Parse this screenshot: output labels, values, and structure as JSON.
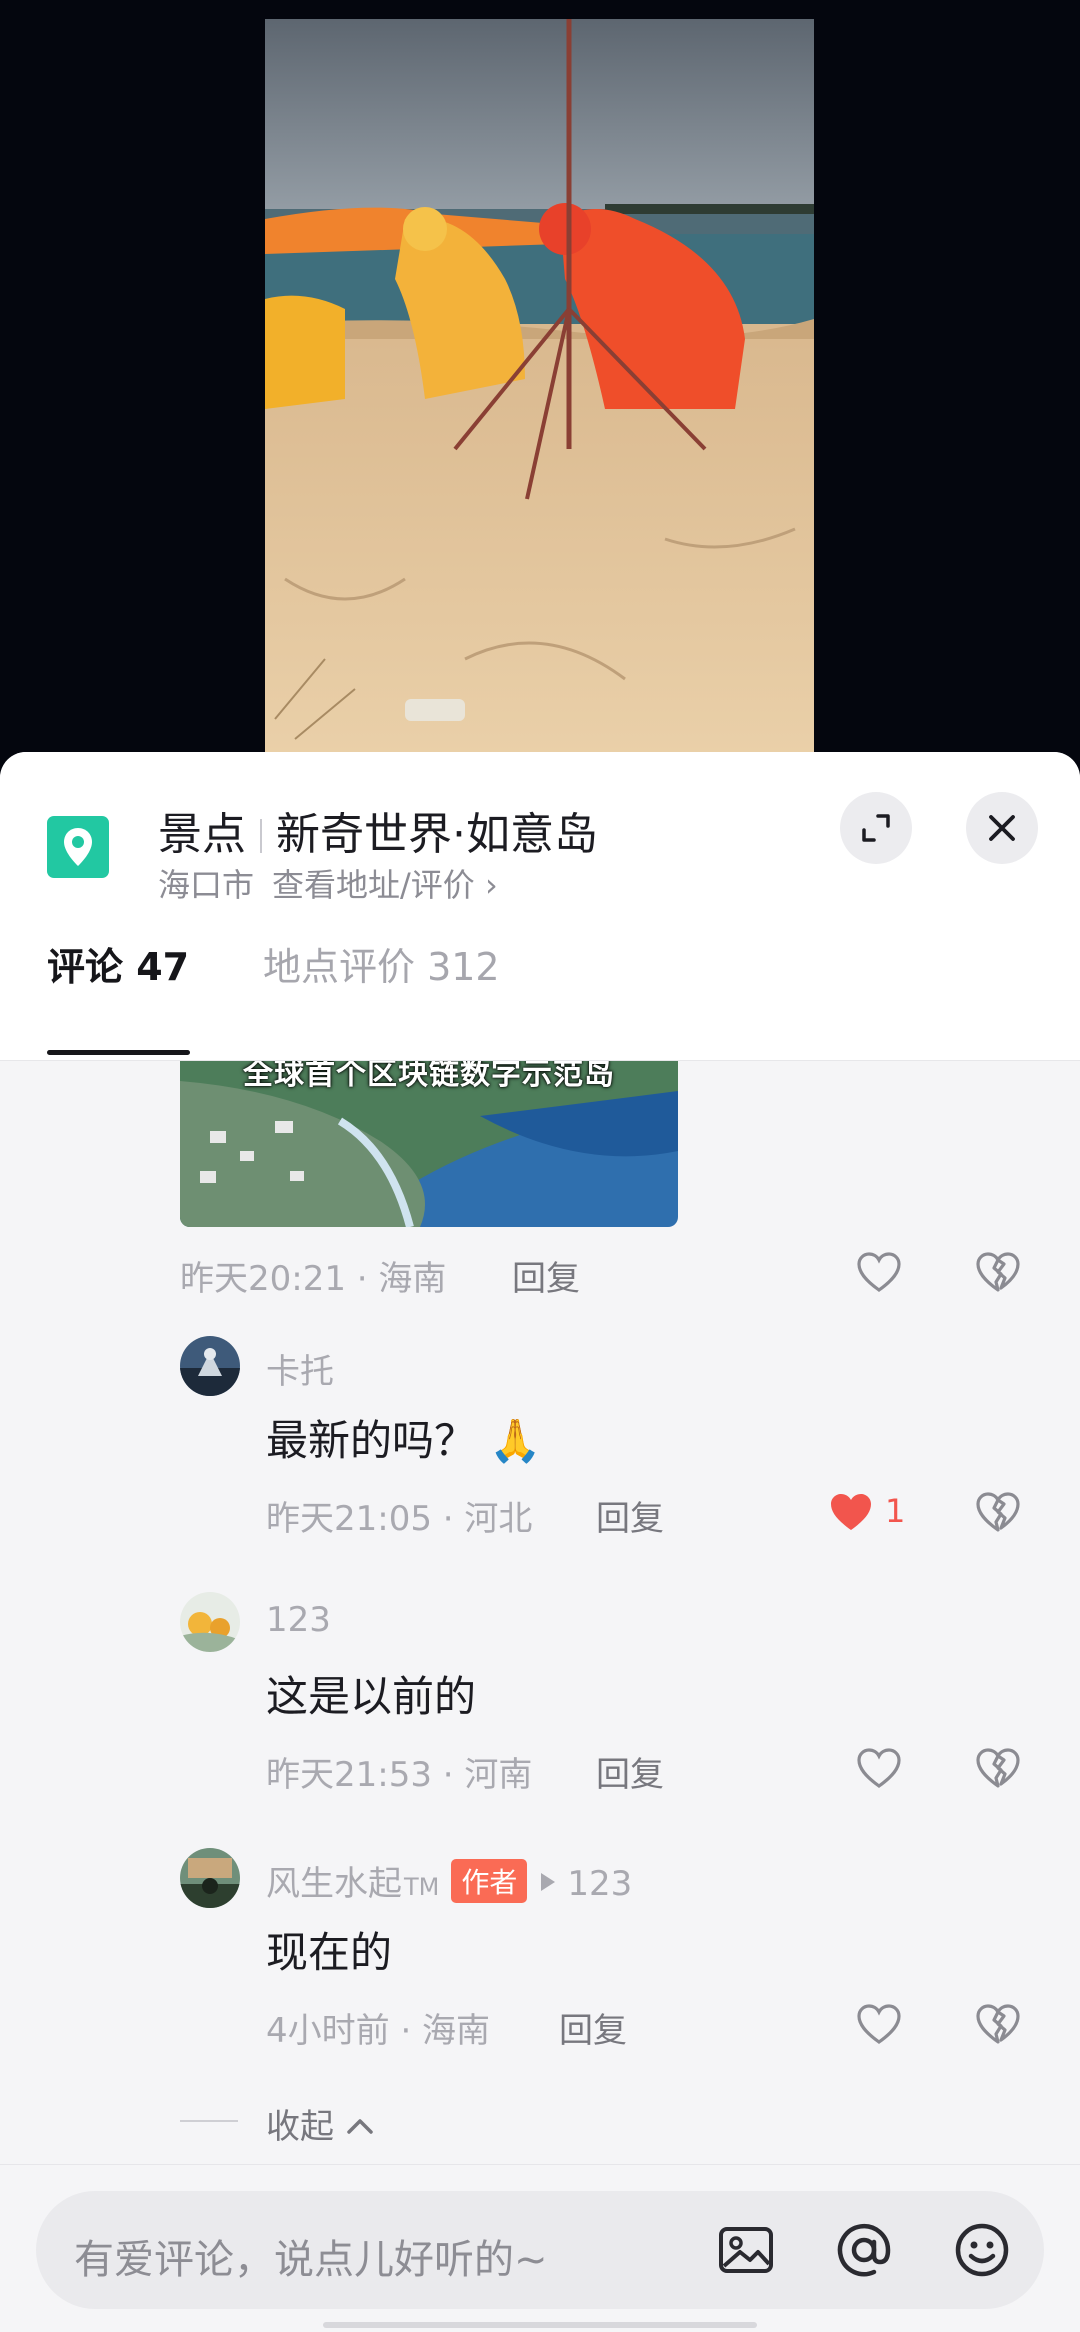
{
  "location": {
    "category": "景点",
    "name": "新奇世界·如意岛",
    "city": "海口市",
    "link": "查看地址/评价 ›"
  },
  "tabs": [
    {
      "label": "评论 47",
      "active": true
    },
    {
      "label": "地点评价 312",
      "active": false
    }
  ],
  "thumbnail_caption": "全球首个区块链数字示范岛",
  "comments": [
    {
      "meta": "昨天20:21 · 海南",
      "reply": "回复",
      "liked": false,
      "likes": ""
    },
    {
      "user": "卡托",
      "text": "最新的吗？",
      "emoji": "🙏",
      "meta": "昨天21:05 · 河北",
      "reply": "回复",
      "liked": true,
      "likes": "1"
    },
    {
      "user": "123",
      "text": "这是以前的",
      "meta": "昨天21:53 · 河南",
      "reply": "回复",
      "liked": false,
      "likes": ""
    },
    {
      "user": "风生水起",
      "tm": "TM",
      "badge": "作者",
      "reply_to": "123",
      "text": "现在的",
      "meta": "4小时前 · 海南",
      "reply": "回复",
      "liked": false,
      "likes": ""
    }
  ],
  "collapse_label": "收起",
  "input": {
    "placeholder": "有爱评论，说点儿好听的~"
  },
  "icons": [
    "map-pin-icon",
    "expand-icon",
    "close-icon",
    "heart-icon",
    "broken-heart-icon",
    "image-icon",
    "at-icon",
    "emoji-icon"
  ],
  "colors": {
    "accent_pin": "#22c8a2",
    "like_red": "#f2554d",
    "author_badge": "#fa6b55"
  }
}
